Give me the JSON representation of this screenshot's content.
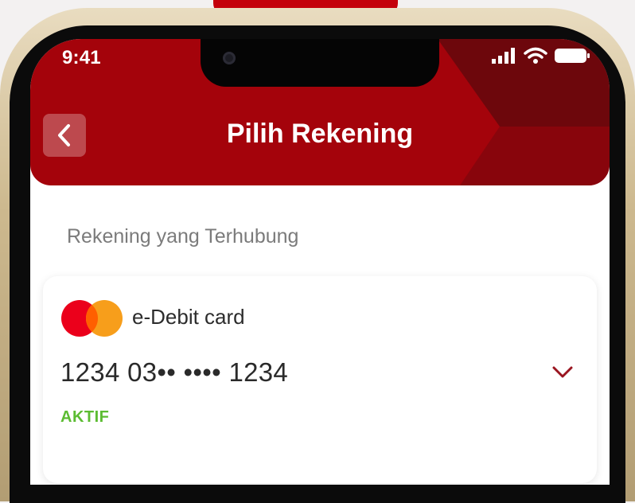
{
  "status_bar": {
    "time": "9:41",
    "icons": [
      "signal-icon",
      "wifi-icon",
      "battery-icon"
    ]
  },
  "header": {
    "title": "Pilih Rekening",
    "back_icon": "chevron-left-icon",
    "color": "#a4030b"
  },
  "section": {
    "label": "Rekening yang Terhubung"
  },
  "account": {
    "card_type": "e-Debit card",
    "card_number": "1234 03•• •••• 1234",
    "status": "AKTIF",
    "status_color": "#5cbc32",
    "logo": "mastercard-logo",
    "expand_icon": "chevron-down-icon"
  }
}
